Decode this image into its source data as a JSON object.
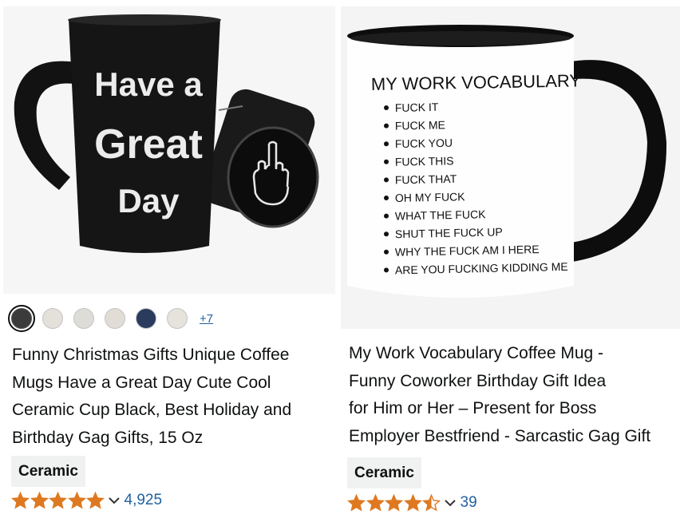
{
  "products": [
    {
      "image": {
        "printed_text": [
          "Have a",
          "Great",
          "Day"
        ],
        "mug_color": "#151515"
      },
      "swatches": [
        {
          "color": "#3b3b3b",
          "selected": true
        },
        {
          "color": "#e4e0da",
          "selected": false
        },
        {
          "color": "#dedcd6",
          "selected": false
        },
        {
          "color": "#e1ddd6",
          "selected": false
        },
        {
          "color": "#2a3b5e",
          "selected": false
        },
        {
          "color": "#e6e3dd",
          "selected": false
        }
      ],
      "more_colors": "+7",
      "title_lines": [
        "Funny Christmas Gifts Unique Coffee",
        "Mugs Have a Great Day Cute Cool",
        "Ceramic Cup Black, Best Holiday and",
        "Birthday Gag Gifts, 15 Oz"
      ],
      "badge": "Ceramic",
      "stars": 5,
      "rating_count": "4,925"
    },
    {
      "image": {
        "heading": "MY WORK VOCABULARY",
        "list": [
          "FUCK IT",
          "FUCK ME",
          "FUCK YOU",
          "FUCK THIS",
          "FUCK THAT",
          "OH MY FUCK",
          "WHAT THE FUCK",
          "SHUT THE FUCK UP",
          "WHY THE FUCK AM I HERE",
          "ARE YOU FUCKING KIDDING ME"
        ],
        "mug_color": "#ffffff",
        "handle_color": "#111111"
      },
      "title_lines": [
        "My Work Vocabulary Coffee Mug -",
        "Funny Coworker Birthday Gift Idea",
        "for Him or Her – Present for Boss",
        "Employer Bestfriend - Sarcastic Gag Gift"
      ],
      "badge": "Ceramic",
      "stars": 4.5,
      "rating_count": "39"
    }
  ],
  "colors": {
    "star_fill": "#de7921",
    "link": "#2162a1",
    "badge_bg": "#f0f2f2"
  }
}
